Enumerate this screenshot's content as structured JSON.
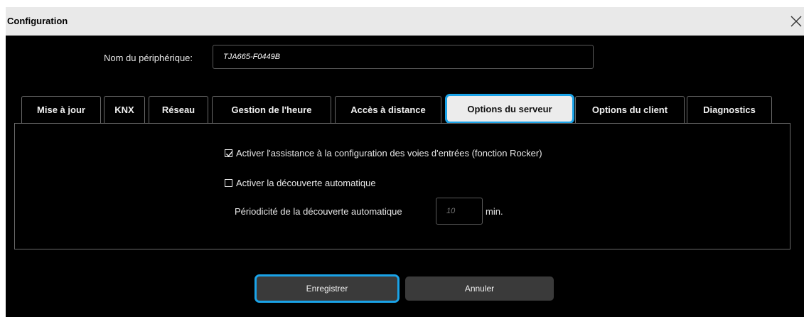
{
  "window": {
    "title": "Configuration",
    "close_icon": "close-icon"
  },
  "device": {
    "label": "Nom du périphérique:",
    "value": "TJA665-F0449B"
  },
  "tabs": [
    {
      "label": "Mise à jour",
      "active": false
    },
    {
      "label": "KNX",
      "active": false
    },
    {
      "label": "Réseau",
      "active": false
    },
    {
      "label": "Gestion de l'heure",
      "active": false
    },
    {
      "label": "Accès à distance",
      "active": false
    },
    {
      "label": "Options du serveur",
      "active": true
    },
    {
      "label": "Options du client",
      "active": false
    },
    {
      "label": "Diagnostics",
      "active": false
    }
  ],
  "options": {
    "rocker": {
      "label": "Activer l'assistance à la configuration des voies d'entrées (fonction Rocker)",
      "checked": true
    },
    "discovery": {
      "label": "Activer la découverte automatique",
      "checked": false
    },
    "period": {
      "label": "Périodicité de la découverte automatique",
      "placeholder": "10",
      "unit": "min."
    }
  },
  "buttons": {
    "save": "Enregistrer",
    "cancel": "Annuler"
  },
  "colors": {
    "accent": "#1aa3e8",
    "background": "#000000",
    "titlebar": "#e9e9e9"
  }
}
